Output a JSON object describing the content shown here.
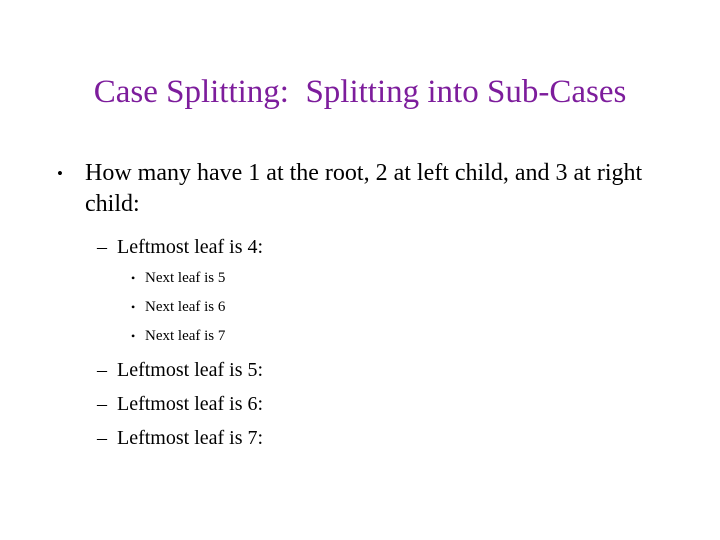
{
  "slide": {
    "title": "Case Splitting:  Splitting into Sub-Cases",
    "title_color": "#7d1d9c",
    "body_color": "#000000",
    "background_color": "#ffffff",
    "markers": {
      "level1": "•",
      "level2": "–",
      "level3": "•"
    },
    "content": [
      {
        "level": 1,
        "marker": "•",
        "text": "How many have 1 at the root, 2 at left child, and 3 at right child:"
      },
      {
        "level": 2,
        "marker": "–",
        "text": "Leftmost leaf is 4:"
      },
      {
        "level": 3,
        "marker": "•",
        "text": "Next leaf is 5"
      },
      {
        "level": 3,
        "marker": "•",
        "text": "Next leaf is 6"
      },
      {
        "level": 3,
        "marker": "•",
        "text": "Next leaf is 7"
      },
      {
        "level": 2,
        "marker": "–",
        "text": "Leftmost leaf is 5:"
      },
      {
        "level": 2,
        "marker": "–",
        "text": "Leftmost leaf is 6:"
      },
      {
        "level": 2,
        "marker": "–",
        "text": "Leftmost leaf is 7:"
      }
    ]
  }
}
